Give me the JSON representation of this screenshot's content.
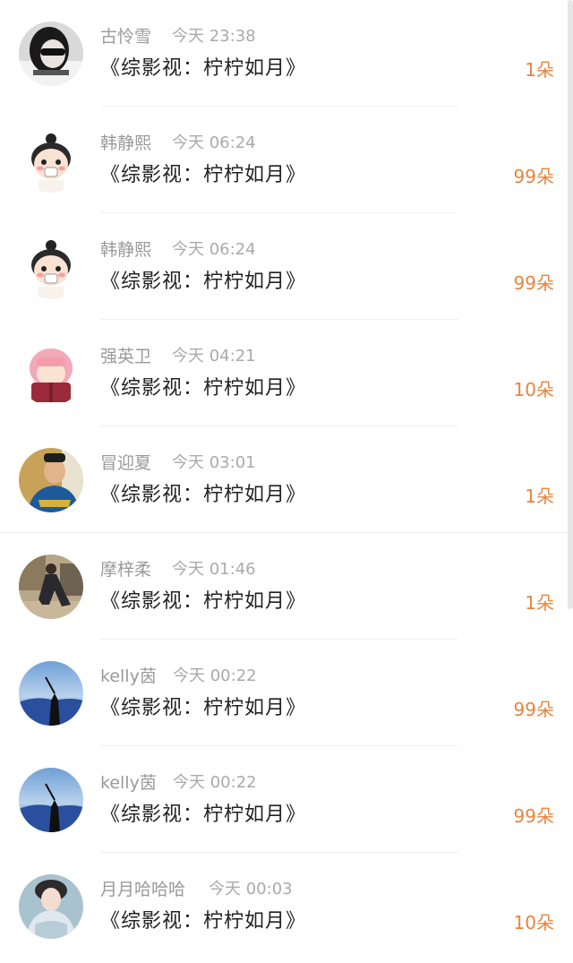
{
  "book_title": "《综影视：柠柠如月》",
  "items": [
    {
      "username": "古怜雪",
      "time": "今天 23:38",
      "gift": "1朵",
      "avatar_icon": "user-avatar-sunglasses"
    },
    {
      "username": "韩静熙",
      "time": "今天 06:24",
      "gift": "99朵",
      "avatar_icon": "user-avatar-cartoon-girl"
    },
    {
      "username": "韩静熙",
      "time": "今天 06:24",
      "gift": "99朵",
      "avatar_icon": "user-avatar-cartoon-girl"
    },
    {
      "username": "强英卫",
      "time": "今天 04:21",
      "gift": "10朵",
      "avatar_icon": "user-avatar-pink-hair-reading"
    },
    {
      "username": "冒迎夏",
      "time": "今天 03:01",
      "gift": "1朵",
      "avatar_icon": "user-avatar-man-costume"
    },
    {
      "username": "摩梓柔",
      "time": "今天 01:46",
      "gift": "1朵",
      "avatar_icon": "user-avatar-man-seated"
    },
    {
      "username": "kelly茵",
      "time": "今天 00:22",
      "gift": "99朵",
      "avatar_icon": "user-avatar-silhouette-sky"
    },
    {
      "username": "kelly茵",
      "time": "今天 00:22",
      "gift": "99朵",
      "avatar_icon": "user-avatar-silhouette-sky"
    },
    {
      "username": "月月哈哈哈",
      "time": "今天 00:03",
      "gift": "10朵",
      "avatar_icon": "user-avatar-costume-woman"
    }
  ],
  "colors": {
    "gift": "#e8843c",
    "username": "#9a9a9a",
    "time": "#aaaaaa",
    "title": "#222222"
  }
}
